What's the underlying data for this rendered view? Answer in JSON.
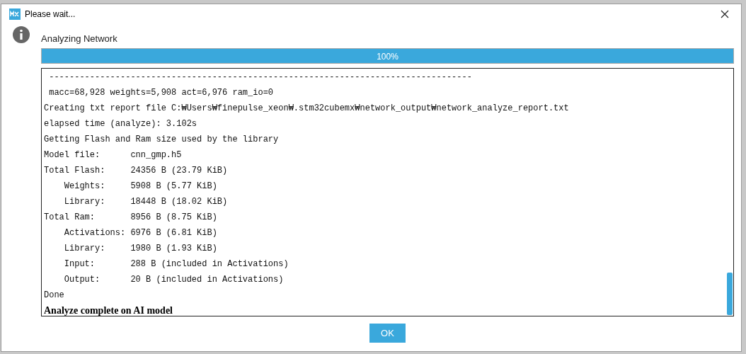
{
  "window": {
    "title": "Please wait..."
  },
  "status": "Analyzing Network",
  "progress": {
    "level": 1,
    "reading": "100%"
  },
  "log": [
    {
      "kind": "plain",
      "text": " -----------------------------------------------------------------------------------"
    },
    {
      "kind": "plain",
      "text": " macc=68,928 weights=5,908 act=6,976 ram_io=0"
    },
    {
      "kind": "plain",
      "text": "Creating txt report file C:₩Users₩finepulse_xeon₩.stm32cubemx₩network_output₩network_analyze_report.txt"
    },
    {
      "kind": "plain",
      "text": "elapsed time (analyze): 3.102s"
    },
    {
      "kind": "plain",
      "text": "Getting Flash and Ram size used by the library"
    },
    {
      "kind": "plain",
      "text": "Model file:      cnn_gmp.h5"
    },
    {
      "kind": "plain",
      "text": "Total Flash:     24356 B (23.79 KiB)"
    },
    {
      "kind": "plain",
      "text": "    Weights:     5908 B (5.77 KiB)"
    },
    {
      "kind": "plain",
      "text": "    Library:     18448 B (18.02 KiB)"
    },
    {
      "kind": "plain",
      "text": "Total Ram:       8956 B (8.75 KiB)"
    },
    {
      "kind": "plain",
      "text": "    Activations: 6976 B (6.81 KiB)"
    },
    {
      "kind": "plain",
      "text": "    Library:     1980 B (1.93 KiB)"
    },
    {
      "kind": "plain",
      "text": "    Input:       288 B (included in Activations)"
    },
    {
      "kind": "plain",
      "text": "    Output:      20 B (included in Activations)"
    },
    {
      "kind": "plain",
      "text": "Done"
    },
    {
      "kind": "bold",
      "text": "Analyze complete on AI model"
    }
  ],
  "buttons": [
    "OK"
  ]
}
